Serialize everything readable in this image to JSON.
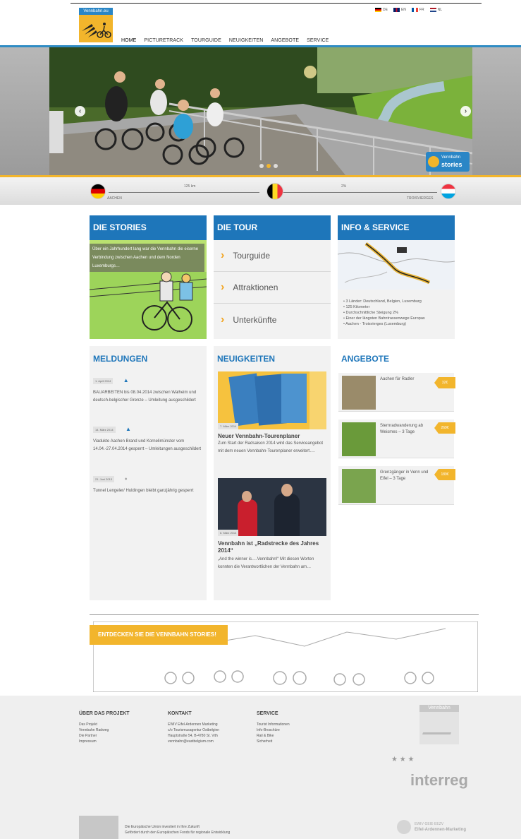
{
  "brand": {
    "logo_text": "Vennbahn.eu"
  },
  "languages": [
    {
      "code": "DE"
    },
    {
      "code": "EN"
    },
    {
      "code": "FR"
    },
    {
      "code": "NL"
    }
  ],
  "nav": [
    "HOME",
    "PICTURETRACK",
    "TOURGUIDE",
    "NEUIGKEITEN",
    "ANGEBOTE",
    "SERVICE"
  ],
  "hero": {
    "badge_top": "Vennbahn",
    "badge_bottom": "stories"
  },
  "route": {
    "start": "AACHEN",
    "end": "TROISVIERGES",
    "distance": "125 km",
    "gradient": "2%"
  },
  "stories": {
    "title": "DIE STORIES",
    "text": "Über ein Jahrhundert lang war die Vennbahn die eiserne Verbindung zwischen Aachen und dem Norden Luxemburgs…"
  },
  "tour": {
    "title": "DIE TOUR",
    "items": [
      "Tourguide",
      "Attraktionen",
      "Unterkünfte"
    ]
  },
  "info": {
    "title": "INFO & SERVICE",
    "bullets": [
      "3 Länder: Deutschland, Belgien, Luxemburg",
      "125 Kilometer",
      "Durchschnittliche Steigung 2%",
      "Einer der längsten Bahntrassenwege Europas",
      "Aachen - Troisvierges (Luxemburg)"
    ]
  },
  "meldungen": {
    "title": "MELDUNGEN",
    "items": [
      {
        "date": "1. April 2014",
        "text": "BAUARBEITEN bis 08.04.2014 zwischen Walheim und deutsch-belgischer Grenze – Umleitung ausgeschildert"
      },
      {
        "date": "14. März 2014",
        "text": "Viadukte Aachen Brand und Kornelimünster vom 14.04.-27.04.2014 gesperrt – Umleitungen ausgeschildert"
      },
      {
        "date": "21. Juni 2013",
        "text": "Tunnel Lengeler/ Huldingen bleibt ganzjährig gesperrt"
      }
    ]
  },
  "neuigkeiten": {
    "title": "NEUIGKEITEN",
    "items": [
      {
        "date": "7. März 2014",
        "headline": "Neuer Vennbahn-Tourenplaner",
        "text": "Zum Start der Radsaison 2014 wird das Serviceangebot mit dem neuen Vennbahn-Tourenplaner erweitert…."
      },
      {
        "date": "6. März 2014",
        "headline": "Vennbahn ist „Radstrecke des Jahres 2014“",
        "text": "„And the winner is….Vennbahn!“ Mit diesen Worten konnten die Verantwortlichen der Vennbahn am…"
      }
    ]
  },
  "angebote": {
    "title": "ANGEBOTE",
    "items": [
      {
        "text": "Aachen für Radler",
        "price": "32€"
      },
      {
        "text": "Sternradwanderung ab Weismes – 3 Tage",
        "price": "269€"
      },
      {
        "text": "Grenzgänger in Venn und Eifel – 3 Tage",
        "price": "189€"
      }
    ]
  },
  "discover": {
    "button": "ENTDECKEN SIE DIE VENNBAHN STORIES!"
  },
  "footer": {
    "projekt": {
      "title": "ÜBER DAS PROJEKT",
      "links": [
        "Das Projekt",
        "Vennbahn Radweg",
        "Die Partner",
        "Impressum"
      ]
    },
    "kontakt": {
      "title": "KONTAKT",
      "lines": [
        "EWIV Eifel-Ardennen Marketing",
        "c/o Tourismusagentur Ostbelgien",
        "Hauptstraße 54, B-4780 St. Vith",
        "vennbahn@eastbelgium.com"
      ]
    },
    "service": {
      "title": "SERVICE",
      "links": [
        "Tourist Informationen",
        "Info-Broschüre",
        "Rail & Bike",
        "Sicherheit"
      ]
    },
    "eu_line1": "Die Europäische Union investiert in Ihre Zukunft",
    "eu_line2": "Gefördert durch den Europäischen Fonds für regionale Entwicklung",
    "interreg": "interreg",
    "ewiv_line1": "EWIV·GEIE·EEZV",
    "ewiv_line2": "Eifel-Ardennen-Marketing",
    "footer_logo": "Vennbahn"
  }
}
